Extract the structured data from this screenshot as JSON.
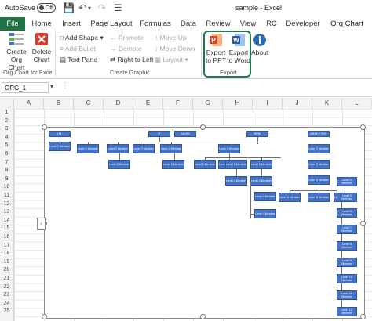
{
  "titlebar": {
    "autosave_label": "AutoSave",
    "autosave_state": "Off",
    "doc_title": "sample - Excel"
  },
  "tabs": [
    "File",
    "Home",
    "Insert",
    "Page Layout",
    "Formulas",
    "Data",
    "Review",
    "View",
    "RC",
    "Developer",
    "Org Chart"
  ],
  "active_tab": "Org Chart",
  "ribbon": {
    "create_label": "Create Org Chart",
    "delete_label": "Delete Chart",
    "group_excel": "Org Chart for Excel",
    "add_shape": "Add Shape",
    "add_bullet": "Add Bullet",
    "text_pane": "Text Pane",
    "promote": "Promote",
    "demote": "Demote",
    "right_to_left": "Right to Left",
    "move_up": "Move Up",
    "move_down": "Move Down",
    "layout": "Layout",
    "group_create_graphic": "Create Graphic",
    "export_ppt": "Export to PPT",
    "export_word": "Export to Word",
    "about": "About",
    "group_export": "Export"
  },
  "namebox": "ORG_1",
  "columns": [
    "A",
    "B",
    "C",
    "D",
    "E",
    "F",
    "G",
    "H",
    "I",
    "J",
    "K",
    "L"
  ],
  "rows": [
    "1",
    "2",
    "3",
    "4",
    "5",
    "6",
    "7",
    "8",
    "9",
    "10",
    "11",
    "12",
    "13",
    "14",
    "15",
    "16",
    "17",
    "18",
    "19",
    "20",
    "21",
    "22",
    "23",
    "24",
    "25"
  ],
  "org": {
    "top_nodes": [
      "HR",
      "IT",
      "SALES",
      "RISK",
      "MARKETING"
    ],
    "member": "Level 2 Member",
    "level3": "Level 3 Member",
    "level4": "Level 4 Member",
    "level5": "Level 5 Member",
    "level6": "Level 6 Member",
    "level7": "Level 7 Member",
    "level8": "Level 8 Member",
    "level9": "Level 9 Member",
    "level10": "Level 10 Member",
    "level11": "Level 11 Member",
    "level12": "Level 12 Member"
  },
  "colors": {
    "excel_green": "#217346",
    "node_blue": "#4472c4",
    "export_highlight": "#1e7a4a"
  }
}
